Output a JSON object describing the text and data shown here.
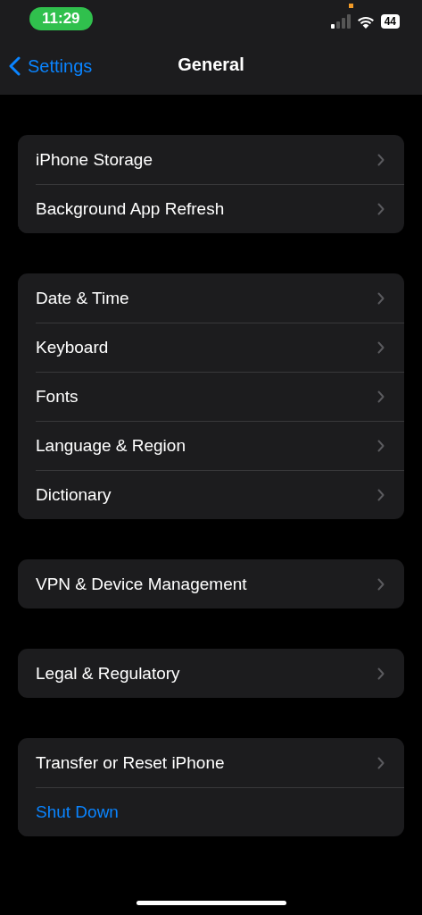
{
  "status_bar": {
    "time": "11:29",
    "battery": "44"
  },
  "nav_bar": {
    "back": "Settings",
    "title": "General"
  },
  "groups": [
    {
      "rows": [
        {
          "kind": "nav",
          "label": "iPhone Storage"
        },
        {
          "kind": "nav",
          "label": "Background App Refresh"
        }
      ]
    },
    {
      "rows": [
        {
          "kind": "nav",
          "label": "Date & Time"
        },
        {
          "kind": "nav",
          "label": "Keyboard"
        },
        {
          "kind": "nav",
          "label": "Fonts"
        },
        {
          "kind": "nav",
          "label": "Language & Region"
        },
        {
          "kind": "nav",
          "label": "Dictionary"
        }
      ]
    },
    {
      "rows": [
        {
          "kind": "nav",
          "label": "VPN & Device Management"
        }
      ]
    },
    {
      "rows": [
        {
          "kind": "nav",
          "label": "Legal & Regulatory"
        }
      ]
    },
    {
      "rows": [
        {
          "kind": "nav",
          "label": "Transfer or Reset iPhone"
        },
        {
          "kind": "action",
          "label": "Shut Down"
        }
      ]
    }
  ]
}
